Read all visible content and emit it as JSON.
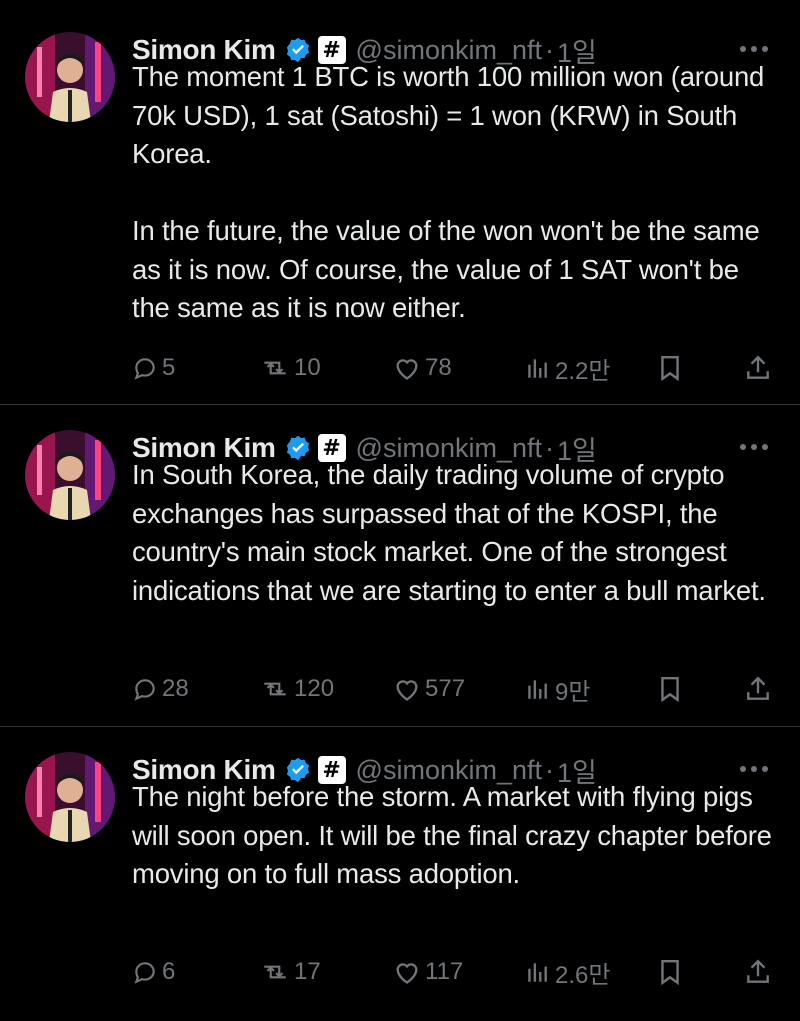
{
  "tweets": [
    {
      "author": {
        "name": "Simon Kim",
        "badge": "#",
        "handle": "@simonkim_nft",
        "separator": "·",
        "time": "1일"
      },
      "text": "The moment 1 BTC is worth 100 million won (around 70k USD), 1 sat (Satoshi) = 1 won (KRW) in South Korea.\n\nIn the future, the value of the won won't be the same as it is now. Of course, the value of 1 SAT won't be the same as it is now either.",
      "stats": {
        "replies": "5",
        "reposts": "10",
        "likes": "78",
        "views": "2.2만"
      }
    },
    {
      "author": {
        "name": "Simon Kim",
        "badge": "#",
        "handle": "@simonkim_nft",
        "separator": "·",
        "time": "1일"
      },
      "text": "In South Korea, the daily trading volume of crypto exchanges has surpassed that of the KOSPI, the country's main stock market. One of the strongest indications that we are starting to enter a bull market.",
      "stats": {
        "replies": "28",
        "reposts": "120",
        "likes": "577",
        "views": "9만"
      }
    },
    {
      "author": {
        "name": "Simon Kim",
        "badge": "#",
        "handle": "@simonkim_nft",
        "separator": "·",
        "time": "1일"
      },
      "text": "The night before the storm. A market with flying pigs will soon open. It will be the final crazy chapter before moving on to full mass adoption.",
      "stats": {
        "replies": "6",
        "reposts": "17",
        "likes": "117",
        "views": "2.6만"
      }
    }
  ],
  "icons": {
    "verified": "verified-badge-icon",
    "more": "more-dots-icon",
    "reply": "reply-bubble-icon",
    "repost": "repost-arrows-icon",
    "like": "heart-icon",
    "views": "analytics-bars-icon",
    "bookmark": "bookmark-icon",
    "share": "share-upload-icon"
  },
  "colors": {
    "background": "#000000",
    "text": "#e7e9ea",
    "muted": "#71767b",
    "divider": "#2f3336",
    "verified": "#1d9bf0"
  }
}
